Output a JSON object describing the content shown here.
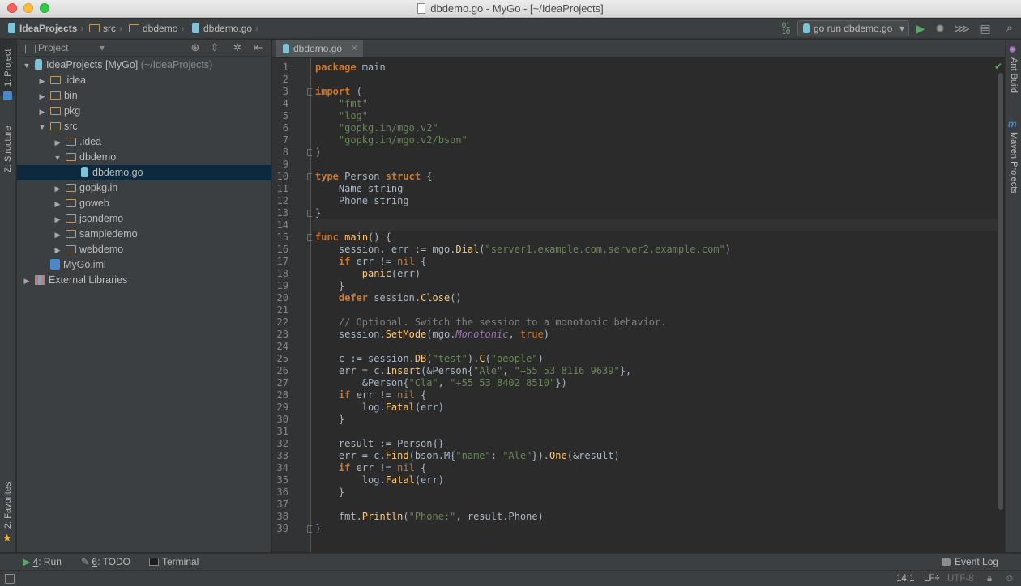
{
  "window": {
    "title": "dbdemo.go - MyGo - [~/IdeaProjects]"
  },
  "breadcrumbs": [
    "IdeaProjects",
    "src",
    "dbdemo",
    "dbdemo.go"
  ],
  "toolbar": {
    "run_config": "go run dbdemo.go"
  },
  "left_tabs": {
    "project": "1: Project",
    "structure": "Z: Structure",
    "favorites": "2: Favorites"
  },
  "right_tabs": {
    "ant": "Ant Build",
    "maven": "Maven Projects"
  },
  "project_panel": {
    "view_selector": "Project"
  },
  "tree": [
    {
      "label": "IdeaProjects [MyGo]",
      "suffix": "(~/IdeaProjects)",
      "depth": 0,
      "arrow": "open",
      "icon": "module"
    },
    {
      "label": ".idea",
      "depth": 1,
      "arrow": "closed",
      "icon": "folder"
    },
    {
      "label": "bin",
      "depth": 1,
      "arrow": "closed",
      "icon": "folder"
    },
    {
      "label": "pkg",
      "depth": 1,
      "arrow": "closed",
      "icon": "folder"
    },
    {
      "label": "src",
      "depth": 1,
      "arrow": "open",
      "icon": "folder"
    },
    {
      "label": ".idea",
      "depth": 2,
      "arrow": "closed",
      "icon": "folder"
    },
    {
      "label": "dbdemo",
      "depth": 2,
      "arrow": "open",
      "icon": "folder"
    },
    {
      "label": "dbdemo.go",
      "depth": 3,
      "arrow": "none",
      "icon": "gofile",
      "selected": true
    },
    {
      "label": "gopkg.in",
      "depth": 2,
      "arrow": "closed",
      "icon": "folder"
    },
    {
      "label": "goweb",
      "depth": 2,
      "arrow": "closed",
      "icon": "folder"
    },
    {
      "label": "jsondemo",
      "depth": 2,
      "arrow": "closed",
      "icon": "folder"
    },
    {
      "label": "sampledemo",
      "depth": 2,
      "arrow": "closed",
      "icon": "folder"
    },
    {
      "label": "webdemo",
      "depth": 2,
      "arrow": "closed",
      "icon": "folder"
    },
    {
      "label": "MyGo.iml",
      "depth": 1,
      "arrow": "none",
      "icon": "iml"
    },
    {
      "label": "External Libraries",
      "depth": 0,
      "arrow": "closed",
      "icon": "library"
    }
  ],
  "editor": {
    "tab": "dbdemo.go",
    "fold_lines": [
      3,
      8,
      10,
      13,
      15,
      39
    ],
    "lines": [
      [
        {
          "t": "package",
          "c": "kw"
        },
        {
          "t": " main"
        }
      ],
      [],
      [
        {
          "t": "import",
          "c": "kw"
        },
        {
          "t": " ("
        }
      ],
      [
        {
          "t": "    "
        },
        {
          "t": "\"fmt\"",
          "c": "st"
        }
      ],
      [
        {
          "t": "    "
        },
        {
          "t": "\"log\"",
          "c": "st"
        }
      ],
      [
        {
          "t": "    "
        },
        {
          "t": "\"gopkg.in/mgo.v2\"",
          "c": "st"
        }
      ],
      [
        {
          "t": "    "
        },
        {
          "t": "\"gopkg.in/mgo.v2/bson\"",
          "c": "st"
        }
      ],
      [
        {
          "t": ")"
        }
      ],
      [],
      [
        {
          "t": "type",
          "c": "kw"
        },
        {
          "t": " Person "
        },
        {
          "t": "struct",
          "c": "kw"
        },
        {
          "t": " {"
        }
      ],
      [
        {
          "t": "    Name "
        },
        {
          "t": "string",
          "c": "ty"
        }
      ],
      [
        {
          "t": "    Phone "
        },
        {
          "t": "string",
          "c": "ty"
        }
      ],
      [
        {
          "t": "}"
        }
      ],
      [],
      [
        {
          "t": "func",
          "c": "kw"
        },
        {
          "t": " "
        },
        {
          "t": "main",
          "c": "fn"
        },
        {
          "t": "() {"
        }
      ],
      [
        {
          "t": "    session, err := mgo."
        },
        {
          "t": "Dial",
          "c": "fn"
        },
        {
          "t": "("
        },
        {
          "t": "\"server1.example.com,server2.example.com\"",
          "c": "st"
        },
        {
          "t": ")"
        }
      ],
      [
        {
          "t": "    "
        },
        {
          "t": "if",
          "c": "kw"
        },
        {
          "t": " err != "
        },
        {
          "t": "nil",
          "c": "kw2"
        },
        {
          "t": " {"
        }
      ],
      [
        {
          "t": "        "
        },
        {
          "t": "panic",
          "c": "fn"
        },
        {
          "t": "(err)"
        }
      ],
      [
        {
          "t": "    }"
        }
      ],
      [
        {
          "t": "    "
        },
        {
          "t": "defer",
          "c": "kw"
        },
        {
          "t": " session."
        },
        {
          "t": "Close",
          "c": "fn"
        },
        {
          "t": "()"
        }
      ],
      [],
      [
        {
          "t": "    // Optional. Switch the session to a monotonic behavior.",
          "c": "cm"
        }
      ],
      [
        {
          "t": "    session."
        },
        {
          "t": "SetMode",
          "c": "fn"
        },
        {
          "t": "(mgo."
        },
        {
          "t": "Monotonic",
          "c": "it"
        },
        {
          "t": ", "
        },
        {
          "t": "true",
          "c": "kw2"
        },
        {
          "t": ")"
        }
      ],
      [],
      [
        {
          "t": "    c := session."
        },
        {
          "t": "DB",
          "c": "fn"
        },
        {
          "t": "("
        },
        {
          "t": "\"test\"",
          "c": "st"
        },
        {
          "t": ")."
        },
        {
          "t": "C",
          "c": "fn"
        },
        {
          "t": "("
        },
        {
          "t": "\"people\"",
          "c": "st"
        },
        {
          "t": ")"
        }
      ],
      [
        {
          "t": "    err = c."
        },
        {
          "t": "Insert",
          "c": "fn"
        },
        {
          "t": "(&Person{"
        },
        {
          "t": "\"Ale\"",
          "c": "st"
        },
        {
          "t": ", "
        },
        {
          "t": "\"+55 53 8116 9639\"",
          "c": "st"
        },
        {
          "t": "},"
        }
      ],
      [
        {
          "t": "        &Person{"
        },
        {
          "t": "\"Cla\"",
          "c": "st"
        },
        {
          "t": ", "
        },
        {
          "t": "\"+55 53 8402 8510\"",
          "c": "st"
        },
        {
          "t": "})"
        }
      ],
      [
        {
          "t": "    "
        },
        {
          "t": "if",
          "c": "kw"
        },
        {
          "t": " err != "
        },
        {
          "t": "nil",
          "c": "kw2"
        },
        {
          "t": " {"
        }
      ],
      [
        {
          "t": "        log."
        },
        {
          "t": "Fatal",
          "c": "fn"
        },
        {
          "t": "(err)"
        }
      ],
      [
        {
          "t": "    }"
        }
      ],
      [],
      [
        {
          "t": "    result := Person{}"
        }
      ],
      [
        {
          "t": "    err = c."
        },
        {
          "t": "Find",
          "c": "fn"
        },
        {
          "t": "(bson.M{"
        },
        {
          "t": "\"name\"",
          "c": "st"
        },
        {
          "t": ": "
        },
        {
          "t": "\"Ale\"",
          "c": "st"
        },
        {
          "t": "})."
        },
        {
          "t": "One",
          "c": "fn"
        },
        {
          "t": "(&result)"
        }
      ],
      [
        {
          "t": "    "
        },
        {
          "t": "if",
          "c": "kw"
        },
        {
          "t": " err != "
        },
        {
          "t": "nil",
          "c": "kw2"
        },
        {
          "t": " {"
        }
      ],
      [
        {
          "t": "        log."
        },
        {
          "t": "Fatal",
          "c": "fn"
        },
        {
          "t": "(err)"
        }
      ],
      [
        {
          "t": "    }"
        }
      ],
      [],
      [
        {
          "t": "    fmt."
        },
        {
          "t": "Println",
          "c": "fn"
        },
        {
          "t": "("
        },
        {
          "t": "\"Phone:\"",
          "c": "st"
        },
        {
          "t": ", result.Phone)"
        }
      ],
      [
        {
          "t": "}"
        }
      ]
    ]
  },
  "bottom_tools": {
    "run_num": "4",
    "run_label": ": Run",
    "todo_num": "6",
    "todo_label": ": TODO",
    "terminal": "Terminal",
    "event_log": "Event Log"
  },
  "status": {
    "position": "14:1",
    "line_sep": "LF÷",
    "encoding": "UTF-8"
  },
  "colors": {
    "keyword": "#cc7832",
    "string": "#6a8759",
    "function": "#ffc66d",
    "comment": "#808080",
    "constant": "#9876aa",
    "text": "#a9b7c6",
    "background": "#2b2b2b",
    "selection": "#0d293e",
    "run": "#59a869"
  }
}
